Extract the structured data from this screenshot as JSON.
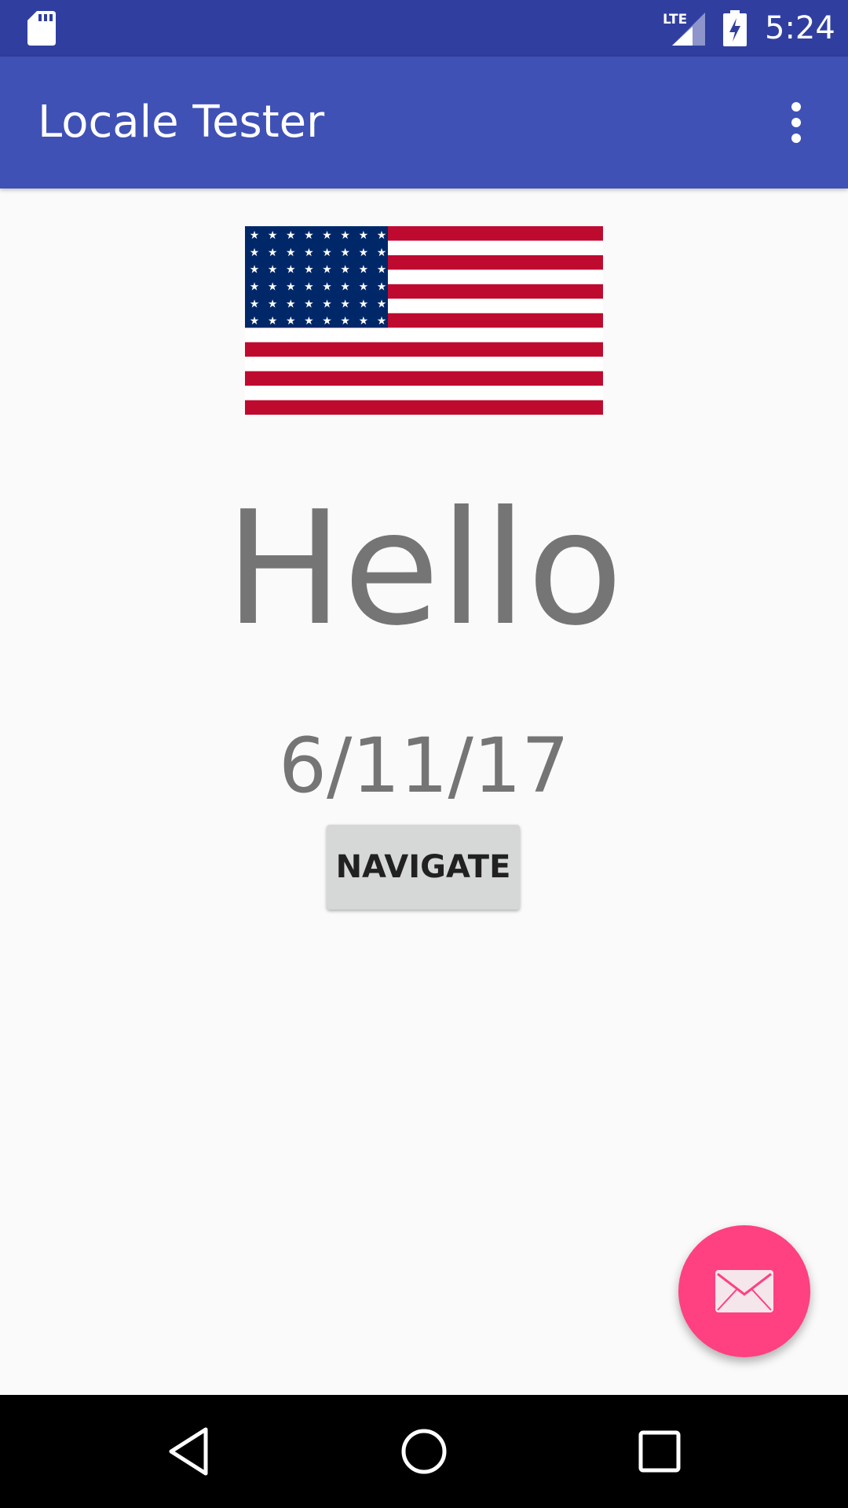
{
  "status_bar": {
    "time": "5:24",
    "network_label": "LTE",
    "icons": [
      "sd-card-icon",
      "lte-signal-icon",
      "battery-charging-icon"
    ]
  },
  "app_bar": {
    "title": "Locale Tester",
    "menu_icon": "overflow-menu-icon"
  },
  "content": {
    "flag_icon": "us-flag-icon",
    "greeting": "Hello",
    "date": "6/11/17",
    "navigate_label": "NAVIGATE"
  },
  "fab": {
    "icon": "mail-icon",
    "color": "#ff4081"
  },
  "nav_bar": {
    "icons": [
      "back-icon",
      "home-icon",
      "recents-icon"
    ]
  },
  "colors": {
    "primary": "#3f51b5",
    "primary_dark": "#303f9f",
    "accent": "#ff4081"
  }
}
